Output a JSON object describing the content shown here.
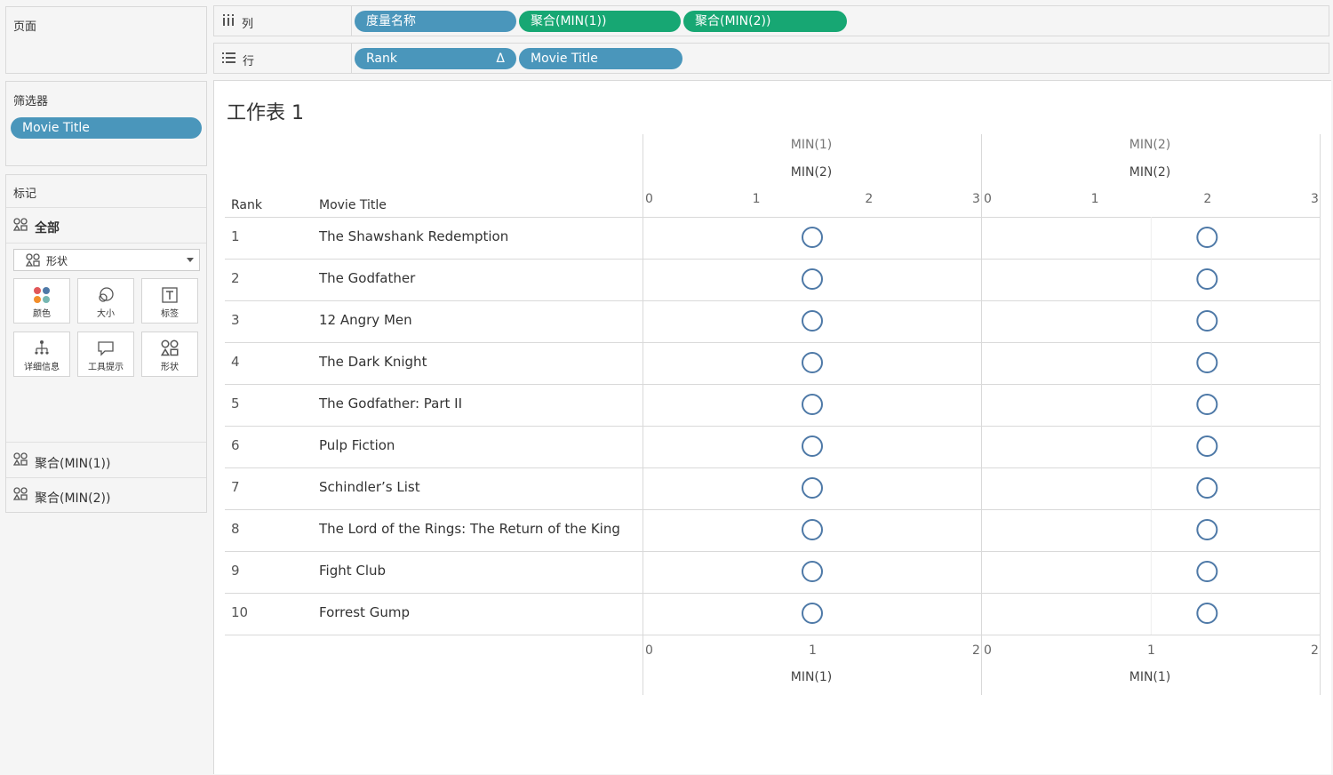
{
  "pages_panel": {
    "title": "页面"
  },
  "filters_panel": {
    "title": "筛选器",
    "pills": [
      "Movie Title"
    ]
  },
  "marks_panel": {
    "title": "标记",
    "all_label": "全部",
    "mark_type": "形状",
    "buttons": [
      {
        "label": "颜色",
        "icon": "color-icon"
      },
      {
        "label": "大小",
        "icon": "size-icon"
      },
      {
        "label": "标签",
        "icon": "label-icon"
      },
      {
        "label": "详细信息",
        "icon": "detail-icon"
      },
      {
        "label": "工具提示",
        "icon": "tooltip-icon"
      },
      {
        "label": "形状",
        "icon": "shape-icon"
      }
    ],
    "measure_items": [
      "聚合(MIN(1))",
      "聚合(MIN(2))"
    ]
  },
  "columns_shelf": {
    "label": "列",
    "pills": [
      {
        "text": "度量名称",
        "color": "#4a96bb"
      },
      {
        "text": "聚合(MIN(1))",
        "color": "#17a773"
      },
      {
        "text": "聚合(MIN(2))",
        "color": "#17a773"
      }
    ]
  },
  "rows_shelf": {
    "label": "行",
    "pills": [
      {
        "text": "Rank",
        "sort_mark": "Δ",
        "color": "#4a96bb"
      },
      {
        "text": "Movie Title",
        "color": "#4a96bb"
      }
    ]
  },
  "sheet": {
    "title": "工作表 1",
    "row_headers": [
      "Rank",
      "Movie Title"
    ],
    "panes": [
      {
        "top_measure": "MIN(1)",
        "top_axis_title": "MIN(2)",
        "top_ticks": [
          "0",
          "1",
          "2",
          "3"
        ],
        "bottom_ticks": [
          "0",
          "1",
          "2"
        ],
        "bottom_axis_title": "MIN(1)"
      },
      {
        "top_measure": "MIN(2)",
        "top_axis_title": "MIN(2)",
        "top_ticks": [
          "0",
          "1",
          "2",
          "3"
        ],
        "bottom_ticks": [
          "0",
          "1",
          "2"
        ],
        "bottom_axis_title": "MIN(1)"
      }
    ],
    "rows": [
      {
        "rank": "1",
        "title": "The Shawshank Redemption"
      },
      {
        "rank": "2",
        "title": "The Godfather"
      },
      {
        "rank": "3",
        "title": "12 Angry Men"
      },
      {
        "rank": "4",
        "title": "The Dark Knight"
      },
      {
        "rank": "5",
        "title": "The Godfather: Part II"
      },
      {
        "rank": "6",
        "title": "Pulp Fiction"
      },
      {
        "rank": "7",
        "title": "Schindler’s List"
      },
      {
        "rank": "8",
        "title": "The Lord of the Rings: The Return of the King"
      },
      {
        "rank": "9",
        "title": "Fight Club"
      },
      {
        "rank": "10",
        "title": "Forrest Gump"
      }
    ],
    "mark_color": "#4e79a7"
  },
  "chart_data": {
    "type": "scatter",
    "series": [
      {
        "values_min1": [
          1,
          1,
          1,
          1,
          1,
          1,
          1,
          1,
          1,
          1
        ],
        "values_min2": [
          1,
          1,
          1,
          1,
          1,
          1,
          1,
          1,
          1,
          1
        ]
      },
      {
        "values_min1": [
          1,
          1,
          1,
          1,
          1,
          1,
          1,
          1,
          1,
          1
        ],
        "values_min2": [
          2,
          2,
          2,
          2,
          2,
          2,
          2,
          2,
          2,
          2
        ]
      }
    ],
    "top_axis_range": [
      0,
      3
    ],
    "bottom_axis_range": [
      0,
      2
    ]
  }
}
